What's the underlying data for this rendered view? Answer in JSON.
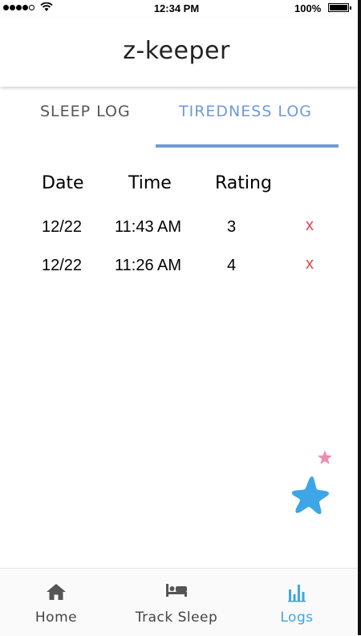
{
  "status_bar": {
    "time": "12:34 PM",
    "battery": "100%",
    "signal_icon": "signal-dots-icon",
    "wifi_icon": "wifi-icon",
    "battery_icon": "battery-full-icon"
  },
  "header": {
    "title": "z-keeper"
  },
  "tabs": [
    {
      "label": "SLEEP LOG",
      "selected": false
    },
    {
      "label": "TIREDNESS LOG",
      "selected": true
    }
  ],
  "log_table": {
    "columns": [
      "Date",
      "Time",
      "Rating"
    ],
    "rows": [
      {
        "date": "12/22",
        "time": "11:43 AM",
        "rating": "3",
        "delete_label": "x"
      },
      {
        "date": "12/22",
        "time": "11:26 AM",
        "rating": "4",
        "delete_label": "x"
      }
    ]
  },
  "decorations": {
    "stars": [
      "pink-star-icon",
      "blue-star-icon"
    ]
  },
  "bottom_nav": {
    "items": [
      {
        "label": "Home",
        "icon": "home-icon",
        "active": false
      },
      {
        "label": "Track Sleep",
        "icon": "bed-icon",
        "active": false
      },
      {
        "label": "Logs",
        "icon": "bar-chart-icon",
        "active": true
      }
    ]
  },
  "colors": {
    "accent_blue": "#6f9ad8",
    "nav_active": "#3ea6e6",
    "delete_red": "#e0454a",
    "star_pink": "#f08bb0",
    "star_blue": "#3ea6e6",
    "nav_inactive": "#444444"
  }
}
